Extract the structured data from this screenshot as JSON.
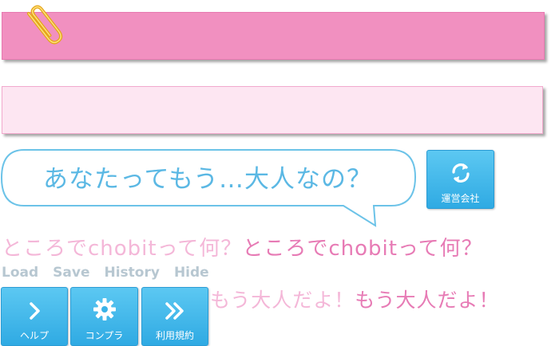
{
  "dialogue": {
    "line": "あなたってもう…大人なの？"
  },
  "company_button": {
    "label": "運営会社",
    "icon": "refresh-icon"
  },
  "question": {
    "faded": "ところでchobitって何？",
    "solid": "ところでchobitって何？"
  },
  "menu": {
    "load": "Load",
    "save": "Save",
    "history": "History",
    "hide": "Hide"
  },
  "buttons": {
    "help": {
      "label": "ヘルプ",
      "icon": "chevron-right-icon"
    },
    "compliance": {
      "label": "コンプラ",
      "icon": "gear-icon"
    },
    "terms": {
      "label": "利用規約",
      "icon": "double-chevron-right-icon"
    }
  },
  "reply": {
    "faded": "もう大人だよ！",
    "solid": "もう大人だよ！"
  },
  "colors": {
    "top_bar": "#f190c0",
    "mid_bar": "#fde6f2",
    "accent_blue": "#39b2e8",
    "accent_pink": "#e77bb5"
  }
}
